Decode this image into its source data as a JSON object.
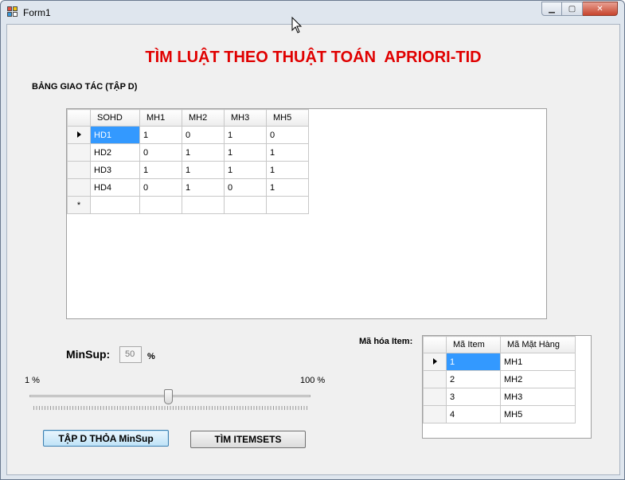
{
  "window": {
    "title": "Form1",
    "minimize_glyph": "▁",
    "maximize_glyph": "▢",
    "close_glyph": "✕"
  },
  "heading": "TÌM LUẬT THEO THUẬT TOÁN  APRIORI-TID",
  "transactions": {
    "label": "BẢNG GIAO TÁC (TẬP D)",
    "columns": [
      "SOHD",
      "MH1",
      "MH2",
      "MH3",
      "MH5"
    ],
    "rows": [
      [
        "HD1",
        "1",
        "0",
        "1",
        "0"
      ],
      [
        "HD2",
        "0",
        "1",
        "1",
        "1"
      ],
      [
        "HD3",
        "1",
        "1",
        "1",
        "1"
      ],
      [
        "HD4",
        "0",
        "1",
        "0",
        "1"
      ]
    ],
    "new_row_marker": "*"
  },
  "minsup": {
    "label": "MinSup:",
    "value": "50",
    "unit": "%",
    "slider_min_label": "1 %",
    "slider_max_label": "100 %",
    "slider_value_percent": 50
  },
  "item_encoding": {
    "label": "Mã hóa Item:",
    "columns": [
      "Mã Item",
      "Mã Mặt Hàng"
    ],
    "rows": [
      [
        "1",
        "MH1"
      ],
      [
        "2",
        "MH2"
      ],
      [
        "3",
        "MH3"
      ],
      [
        "4",
        "MH5"
      ]
    ]
  },
  "buttons": {
    "filter_label": "TẬP D THỎA MinSup",
    "itemsets_label": "TÌM ITEMSETS"
  },
  "colors": {
    "heading": "#e00000",
    "selection": "#3399ff"
  }
}
